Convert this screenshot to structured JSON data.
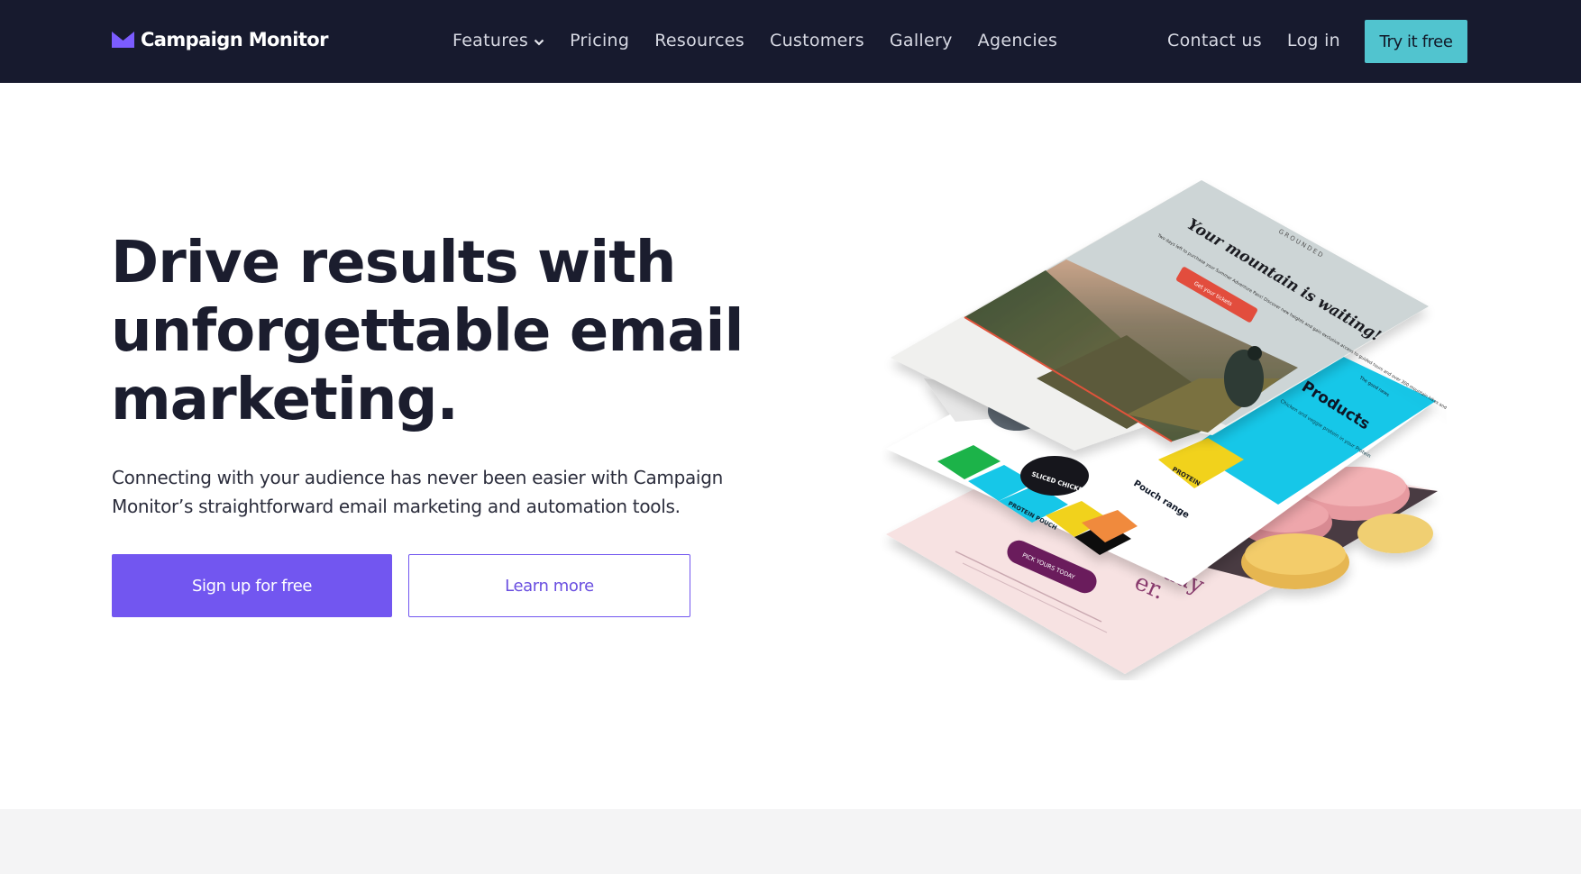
{
  "brand": {
    "name": "Campaign Monitor",
    "accent": "#7256f0",
    "nav_bg": "#171a2e",
    "cta_color": "#51c4cf"
  },
  "nav": {
    "items": [
      {
        "label": "Features",
        "has_dropdown": true
      },
      {
        "label": "Pricing"
      },
      {
        "label": "Resources"
      },
      {
        "label": "Customers"
      },
      {
        "label": "Gallery"
      },
      {
        "label": "Agencies"
      }
    ],
    "contact_label": "Contact us",
    "login_label": "Log in",
    "cta_label": "Try it free"
  },
  "hero": {
    "title": "Drive results with unforgettable email marketing.",
    "subtitle": "Connecting with your audience has never been easier with Campaign Monitor’s straightforward email marketing and automation tools.",
    "primary_cta": "Sign up for free",
    "secondary_cta": "Learn more"
  },
  "illustration": {
    "card1": {
      "brand": "GROUNDED",
      "headline": "Your mountain is waiting!",
      "body": "Two days left to purchase your Summer Adventure Pass! Discover new heights and gain exclusive access to guided tours and over 300 mountain hikes and trails.",
      "button": "Get your tickets"
    },
    "card2": {
      "headline": "Products",
      "tag": "The good news",
      "body": "Chicken and veggie protein in your Protein",
      "product_a": "SLICED CHICKEN",
      "product_b": "PROTEIN POUCH",
      "caption": "Pouch range"
    },
    "card3": {
      "headline_a": "day",
      "headline_b": "er.",
      "button": "PICK YOURS TODAY"
    }
  }
}
